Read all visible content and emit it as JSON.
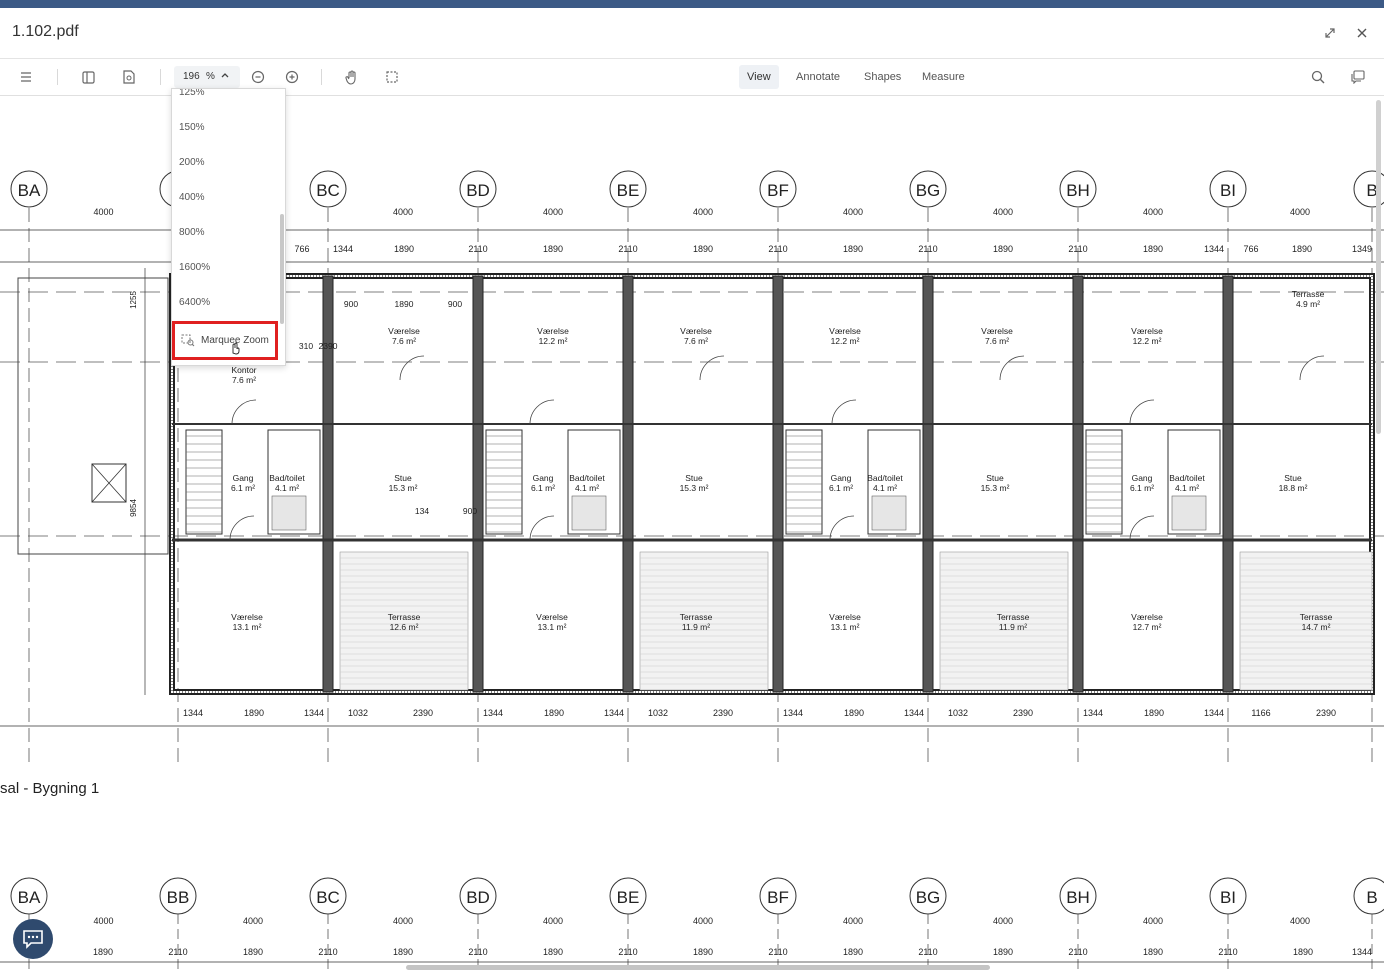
{
  "window": {
    "title": "1.102.pdf"
  },
  "toolbar": {
    "zoom_value": "196",
    "zoom_unit": "%",
    "tabs": [
      {
        "label": "View",
        "active": true
      },
      {
        "label": "Annotate",
        "active": false
      },
      {
        "label": "Shapes",
        "active": false
      },
      {
        "label": "Measure",
        "active": false
      }
    ]
  },
  "zoom_menu": {
    "options": [
      "125%",
      "150%",
      "200%",
      "400%",
      "800%",
      "1600%",
      "6400%"
    ],
    "marquee_label": "Marquee Zoom"
  },
  "drawing": {
    "grid_top": [
      "BA",
      "B",
      "BC",
      "BD",
      "BE",
      "BF",
      "BG",
      "BH",
      "BI",
      "B"
    ],
    "grid_bottom": [
      "BA",
      "BB",
      "BC",
      "BD",
      "BE",
      "BF",
      "BG",
      "BH",
      "BI",
      "B"
    ],
    "bay_dims_top": [
      "4000",
      "4000",
      "4000",
      "4000",
      "4000",
      "4000",
      "4000",
      "4000",
      "4000"
    ],
    "bay_dims_bottom": [
      "4000",
      "4000",
      "4000",
      "4000",
      "4000",
      "4000",
      "4000",
      "4000",
      "4000"
    ],
    "wall_dims_top": [
      "766",
      "1344",
      "1890",
      "2110",
      "1890",
      "2110",
      "1890",
      "2110",
      "1890",
      "2110",
      "1890",
      "2110",
      "1890",
      "1344",
      "766",
      "1890",
      "1349"
    ],
    "wall_dims_lower": [
      "1890",
      "2110",
      "1890",
      "2110",
      "1890",
      "2110",
      "1890",
      "2110",
      "1890",
      "2110",
      "1890",
      "2110",
      "1890",
      "2110",
      "1890",
      "2110",
      "1890",
      "1344"
    ],
    "bottom_dims": [
      "1344",
      "1890",
      "1344",
      "1032",
      "2390",
      "1344",
      "1890",
      "1344",
      "1032",
      "2390",
      "1344",
      "1890",
      "1344",
      "1032",
      "2390",
      "1344",
      "1890",
      "1344",
      "1166",
      "2390"
    ],
    "side_dims": [
      "1255",
      "9854"
    ],
    "sheet_label": "sal - Bygning 1",
    "rooms": [
      {
        "name": "Værelse",
        "area": "7.6 m²"
      },
      {
        "name": "Værelse",
        "area": "12.2 m²"
      },
      {
        "name": "Værelse",
        "area": "7.6 m²"
      },
      {
        "name": "Værelse",
        "area": "12.2 m²"
      },
      {
        "name": "Værelse",
        "area": "7.6 m²"
      },
      {
        "name": "Værelse",
        "area": "12.2 m²"
      },
      {
        "name": "Terrasse",
        "area": "4.9 m²"
      },
      {
        "name": "Kontor",
        "area": "7.6 m²"
      },
      {
        "name": "Gang",
        "area": "6.1 m²"
      },
      {
        "name": "Bad/toilet",
        "area": "4.1 m²"
      },
      {
        "name": "Stue",
        "area": "15.3 m²"
      },
      {
        "name": "Gang",
        "area": "6.1 m²"
      },
      {
        "name": "Bad/toilet",
        "area": "4.1 m²"
      },
      {
        "name": "Stue",
        "area": "15.3 m²"
      },
      {
        "name": "Gang",
        "area": "6.1 m²"
      },
      {
        "name": "Bad/toilet",
        "area": "4.1 m²"
      },
      {
        "name": "Stue",
        "area": "15.3 m²"
      },
      {
        "name": "Gang",
        "area": "6.1 m²"
      },
      {
        "name": "Bad/toilet",
        "area": "4.1 m²"
      },
      {
        "name": "Stue",
        "area": "18.8 m²"
      },
      {
        "name": "Værelse",
        "area": "13.1 m²"
      },
      {
        "name": "Terrasse",
        "area": "12.6 m²"
      },
      {
        "name": "Værelse",
        "area": "13.1 m²"
      },
      {
        "name": "Terrasse",
        "area": "11.9 m²"
      },
      {
        "name": "Værelse",
        "area": "13.1 m²"
      },
      {
        "name": "Terrasse",
        "area": "11.9 m²"
      },
      {
        "name": "Værelse",
        "area": "12.7 m²"
      },
      {
        "name": "Terrasse",
        "area": "14.7 m²"
      }
    ],
    "door_dims": [
      "900",
      "1890",
      "900",
      "310",
      "2390",
      "134"
    ]
  }
}
